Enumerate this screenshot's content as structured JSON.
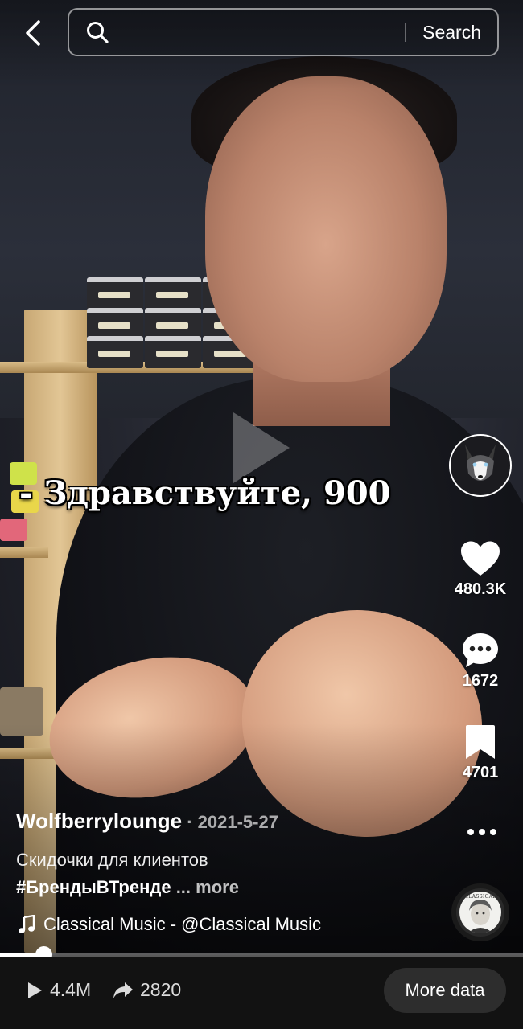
{
  "search": {
    "placeholder": "",
    "value": "",
    "button_label": "Search"
  },
  "video": {
    "subtitle_overlay": "- Здравствуйте, 900",
    "progress_fraction": 0.083
  },
  "actions": {
    "likes": "480.3K",
    "comments": "1672",
    "saves": "4701"
  },
  "post": {
    "author": "Wolfberrylounge",
    "date_separator": " · ",
    "date": "2021-5-27",
    "description": "Скидочки для клиентов",
    "hashtag": "#БрендыВТренде",
    "ellipsis": " ... ",
    "more_label": "more",
    "music": "Classical Music - @Classical Music",
    "disc_label": "CLASSICAL MU"
  },
  "stats": {
    "views": "4.4M",
    "shares": "2820",
    "more_data_label": "More data"
  },
  "icons": {
    "back": "chevron-left-icon",
    "search": "search-icon",
    "like": "heart-icon",
    "comment": "comment-bubble-icon",
    "save": "bookmark-icon",
    "more": "ellipsis-icon",
    "music": "music-note-icon",
    "views": "play-icon",
    "shares": "share-arrow-icon"
  }
}
